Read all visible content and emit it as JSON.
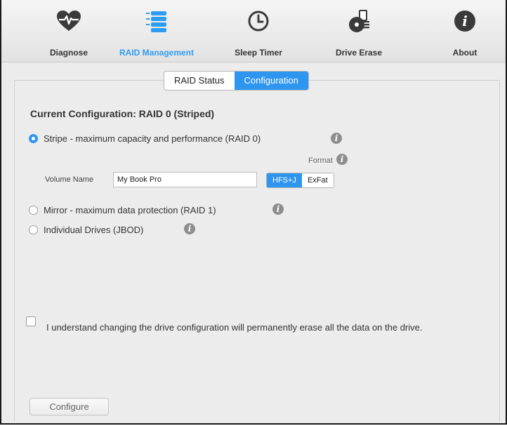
{
  "toolbar": {
    "items": [
      {
        "label": "Diagnose",
        "icon": "heart-pulse-icon"
      },
      {
        "label": "RAID Management",
        "icon": "database-stack-icon"
      },
      {
        "label": "Sleep Timer",
        "icon": "clock-icon"
      },
      {
        "label": "Drive Erase",
        "icon": "disk-erase-icon"
      },
      {
        "label": "About",
        "icon": "info-icon"
      }
    ],
    "active": "RAID Management",
    "accent": "#2e9cf4"
  },
  "tabs": [
    {
      "label": "RAID Status",
      "selected": false
    },
    {
      "label": "Configuration",
      "selected": true
    }
  ],
  "config": {
    "heading": "Current Configuration: RAID 0 (Striped)",
    "options": [
      {
        "label": "Stripe - maximum capacity and performance (RAID 0)",
        "selected": true
      },
      {
        "label": "Mirror - maximum data protection (RAID 1)",
        "selected": false
      },
      {
        "label": "Individual Drives (JBOD)",
        "selected": false
      }
    ],
    "format_label": "Format",
    "volume_label": "Volume Name",
    "volume_value": "My Book Pro",
    "formats": [
      {
        "label": "HFS+J",
        "selected": true
      },
      {
        "label": "ExFat",
        "selected": false
      }
    ]
  },
  "confirm": {
    "text": "I understand changing the drive configuration will permanently erase all the data on the drive.",
    "checked": false
  },
  "configure_button": "Configure"
}
